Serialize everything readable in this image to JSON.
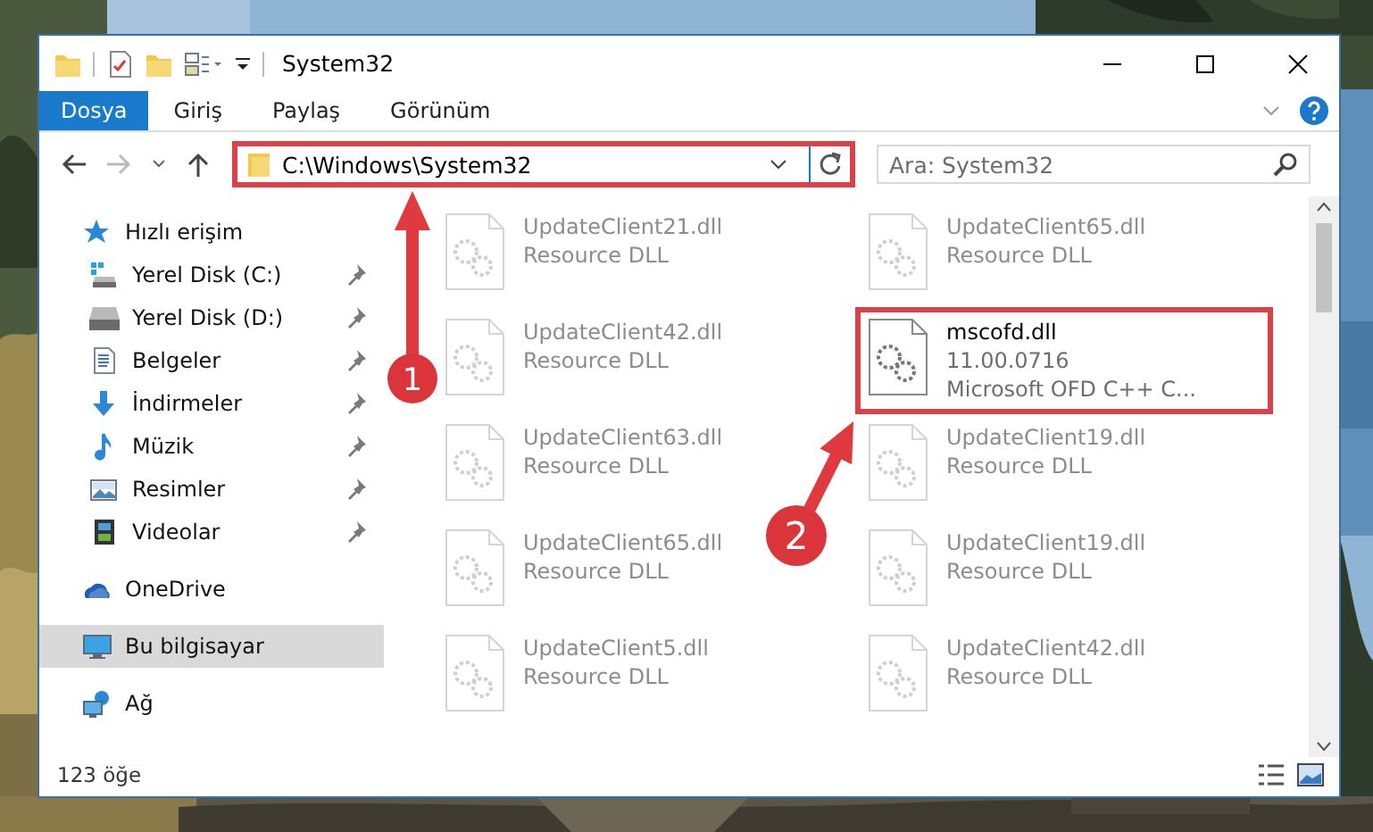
{
  "window": {
    "title": "System32"
  },
  "ribbon": {
    "tabs": [
      {
        "label": "Dosya",
        "selected": true
      },
      {
        "label": "Giriş",
        "selected": false
      },
      {
        "label": "Paylaş",
        "selected": false
      },
      {
        "label": "Görünüm",
        "selected": false
      }
    ]
  },
  "address_bar": {
    "path": "C:\\Windows\\System32",
    "highlighted": true
  },
  "search": {
    "placeholder": "Ara: System32"
  },
  "sidebar": {
    "items": [
      {
        "label": "Hızlı erişim",
        "kind": "star",
        "selected": false,
        "children": [
          {
            "label": "Yerel Disk (C:)",
            "kind": "system-drive",
            "pinned": true,
            "selected": false
          },
          {
            "label": "Yerel Disk (D:)",
            "kind": "drive",
            "pinned": true,
            "selected": false
          },
          {
            "label": "Belgeler",
            "kind": "documents",
            "pinned": true,
            "selected": false
          },
          {
            "label": "İndirmeler",
            "kind": "downloads",
            "pinned": true,
            "selected": false
          },
          {
            "label": "Müzik",
            "kind": "music",
            "pinned": true,
            "selected": false
          },
          {
            "label": "Resimler",
            "kind": "pictures",
            "pinned": true,
            "selected": false
          },
          {
            "label": "Videolar",
            "kind": "videos",
            "pinned": true,
            "selected": false
          }
        ]
      },
      {
        "label": "OneDrive",
        "kind": "cloud",
        "selected": false
      },
      {
        "label": "Bu bilgisayar",
        "kind": "computer",
        "selected": true
      },
      {
        "label": "Ağ",
        "kind": "network",
        "selected": false
      }
    ]
  },
  "files": [
    {
      "name": "UpdateClient21.dll",
      "lines": [
        "Resource DLL"
      ],
      "faded": true,
      "highlighted": false
    },
    {
      "name": "UpdateClient65.dll",
      "lines": [
        "Resource DLL"
      ],
      "faded": true,
      "highlighted": false
    },
    {
      "name": "UpdateClient42.dll",
      "lines": [
        "Resource DLL"
      ],
      "faded": true,
      "highlighted": false
    },
    {
      "name": "mscofd.dll",
      "lines": [
        "11.00.0716",
        "Microsoft OFD C++ C..."
      ],
      "faded": false,
      "highlighted": true
    },
    {
      "name": "UpdateClient63.dll",
      "lines": [
        "Resource DLL"
      ],
      "faded": true,
      "highlighted": false
    },
    {
      "name": "UpdateClient19.dll",
      "lines": [
        "Resource DLL"
      ],
      "faded": true,
      "highlighted": false
    },
    {
      "name": "UpdateClient65.dll",
      "lines": [
        "Resource DLL"
      ],
      "faded": true,
      "highlighted": false
    },
    {
      "name": "UpdateClient19.dll",
      "lines": [
        "Resource DLL"
      ],
      "faded": true,
      "highlighted": false
    },
    {
      "name": "UpdateClient5.dll",
      "lines": [
        "Resource DLL"
      ],
      "faded": true,
      "highlighted": false
    },
    {
      "name": "UpdateClient42.dll",
      "lines": [
        "Resource DLL"
      ],
      "faded": true,
      "highlighted": false
    }
  ],
  "annotations": [
    {
      "number": "1"
    },
    {
      "number": "2"
    }
  ],
  "status_bar": {
    "count": "123 öğe"
  }
}
